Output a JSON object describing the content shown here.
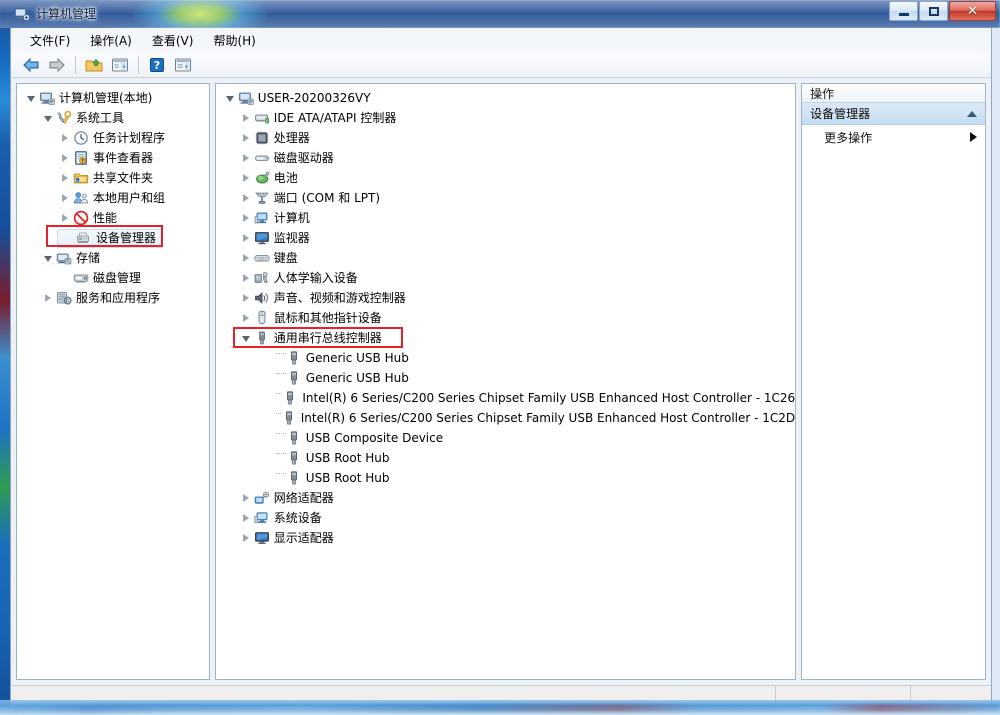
{
  "window": {
    "title": "计算机管理",
    "icon": "computer-management-icon",
    "buttons": {
      "minimize": "–",
      "maximize": "□",
      "close": "✕"
    }
  },
  "menu": {
    "items": [
      {
        "label": "文件(F)",
        "name": "menu-file"
      },
      {
        "label": "操作(A)",
        "name": "menu-action"
      },
      {
        "label": "查看(V)",
        "name": "menu-view"
      },
      {
        "label": "帮助(H)",
        "name": "menu-help"
      }
    ]
  },
  "toolbar": {
    "buttons": [
      {
        "name": "back-button",
        "icon": "arrow-left-icon",
        "label": "后退"
      },
      {
        "name": "forward-button",
        "icon": "arrow-right-icon",
        "label": "前进"
      },
      {
        "name": "up-one-level-button",
        "icon": "folder-up-icon",
        "label": "向上"
      },
      {
        "name": "show-hide-tree-button",
        "icon": "show-tree-icon",
        "label": "显示/隐藏控制台树"
      },
      {
        "name": "help-button",
        "icon": "help-question-icon",
        "label": "帮助"
      },
      {
        "name": "show-action-pane-button",
        "icon": "show-action-pane-icon",
        "label": "显示/隐藏操作窗格"
      }
    ]
  },
  "console_tree": {
    "items": [
      {
        "label": "计算机管理(本地)",
        "icon": "computer-icon",
        "indent": 0,
        "twisty": "open",
        "name": "tree-computer-management-local"
      },
      {
        "label": "系统工具",
        "icon": "tools-icon",
        "indent": 1,
        "twisty": "open",
        "name": "tree-system-tools"
      },
      {
        "label": "任务计划程序",
        "icon": "clock-icon",
        "indent": 2,
        "twisty": "closed",
        "name": "tree-task-scheduler"
      },
      {
        "label": "事件查看器",
        "icon": "event-viewer-icon",
        "indent": 2,
        "twisty": "closed",
        "name": "tree-event-viewer"
      },
      {
        "label": "共享文件夹",
        "icon": "shared-folders-icon",
        "indent": 2,
        "twisty": "closed",
        "name": "tree-shared-folders"
      },
      {
        "label": "本地用户和组",
        "icon": "users-groups-icon",
        "indent": 2,
        "twisty": "closed",
        "name": "tree-local-users-groups"
      },
      {
        "label": "性能",
        "icon": "performance-icon",
        "indent": 2,
        "twisty": "closed",
        "name": "tree-performance"
      },
      {
        "label": "设备管理器",
        "icon": "device-manager-icon",
        "indent": 2,
        "twisty": "none",
        "selected": true,
        "highlight": true,
        "name": "tree-device-manager"
      },
      {
        "label": "存储",
        "icon": "storage-icon",
        "indent": 1,
        "twisty": "open",
        "name": "tree-storage"
      },
      {
        "label": "磁盘管理",
        "icon": "disk-management-icon",
        "indent": 2,
        "twisty": "none",
        "name": "tree-disk-management"
      },
      {
        "label": "服务和应用程序",
        "icon": "services-icon",
        "indent": 1,
        "twisty": "closed",
        "name": "tree-services-and-applications"
      }
    ]
  },
  "device_tree": {
    "root": {
      "label": "USER-20200326VY",
      "icon": "computer-icon",
      "twisty": "open",
      "name": "device-root"
    },
    "items": [
      {
        "label": "IDE ATA/ATAPI 控制器",
        "icon": "ide-controller-icon",
        "twisty": "closed",
        "name": "device-category-ide"
      },
      {
        "label": "处理器",
        "icon": "processor-icon",
        "twisty": "closed",
        "name": "device-category-processors"
      },
      {
        "label": "磁盘驱动器",
        "icon": "disk-drive-icon",
        "twisty": "closed",
        "name": "device-category-disk-drives"
      },
      {
        "label": "电池",
        "icon": "battery-icon",
        "twisty": "closed",
        "name": "device-category-batteries"
      },
      {
        "label": "端口 (COM 和 LPT)",
        "icon": "port-icon",
        "twisty": "closed",
        "name": "device-category-ports"
      },
      {
        "label": "计算机",
        "icon": "computer-small-icon",
        "twisty": "closed",
        "name": "device-category-computer"
      },
      {
        "label": "监视器",
        "icon": "monitor-icon",
        "twisty": "closed",
        "name": "device-category-monitors"
      },
      {
        "label": "键盘",
        "icon": "keyboard-icon",
        "twisty": "closed",
        "name": "device-category-keyboards"
      },
      {
        "label": "人体学输入设备",
        "icon": "hid-icon",
        "twisty": "closed",
        "name": "device-category-hid"
      },
      {
        "label": "声音、视频和游戏控制器",
        "icon": "sound-icon",
        "twisty": "closed",
        "name": "device-category-sound"
      },
      {
        "label": "鼠标和其他指针设备",
        "icon": "mouse-icon",
        "twisty": "closed",
        "name": "device-category-mice"
      },
      {
        "label": "通用串行总线控制器",
        "icon": "usb-icon",
        "twisty": "open",
        "highlight": true,
        "name": "device-category-usb"
      },
      {
        "label": "网络适配器",
        "icon": "network-adapter-icon",
        "twisty": "closed",
        "name": "device-category-network"
      },
      {
        "label": "系统设备",
        "icon": "system-device-icon",
        "twisty": "closed",
        "name": "device-category-system"
      },
      {
        "label": "显示适配器",
        "icon": "display-adapter-icon",
        "twisty": "closed",
        "name": "device-category-display"
      }
    ],
    "usb_children": [
      {
        "label": "Generic USB Hub",
        "icon": "usb-device-icon",
        "name": "device-generic-usb-hub-1"
      },
      {
        "label": "Generic USB Hub",
        "icon": "usb-device-icon",
        "name": "device-generic-usb-hub-2"
      },
      {
        "label": "Intel(R) 6 Series/C200 Series Chipset Family USB Enhanced Host Controller - 1C26",
        "icon": "usb-device-icon",
        "name": "device-intel-ehci-1c26"
      },
      {
        "label": "Intel(R) 6 Series/C200 Series Chipset Family USB Enhanced Host Controller - 1C2D",
        "icon": "usb-device-icon",
        "name": "device-intel-ehci-1c2d"
      },
      {
        "label": "USB Composite Device",
        "icon": "usb-device-icon",
        "name": "device-usb-composite"
      },
      {
        "label": "USB Root Hub",
        "icon": "usb-device-icon",
        "name": "device-usb-root-hub-1"
      },
      {
        "label": "USB Root Hub",
        "icon": "usb-device-icon",
        "name": "device-usb-root-hub-2"
      }
    ]
  },
  "actions_pane": {
    "header": "操作",
    "group_title": "设备管理器",
    "collapse_icon": "chevron-up-icon",
    "rows": [
      {
        "label": "更多操作",
        "submenu_icon": "chevron-right-icon",
        "name": "action-more-actions"
      }
    ]
  },
  "status_bar": {
    "pane1": "",
    "pane2": "",
    "pane3": ""
  },
  "colors": {
    "annotation_red": "#e8202a",
    "selection_blue": "#cde3f7",
    "pane_border": "#a0b4c8",
    "window_frame": "#8ba8c6"
  }
}
